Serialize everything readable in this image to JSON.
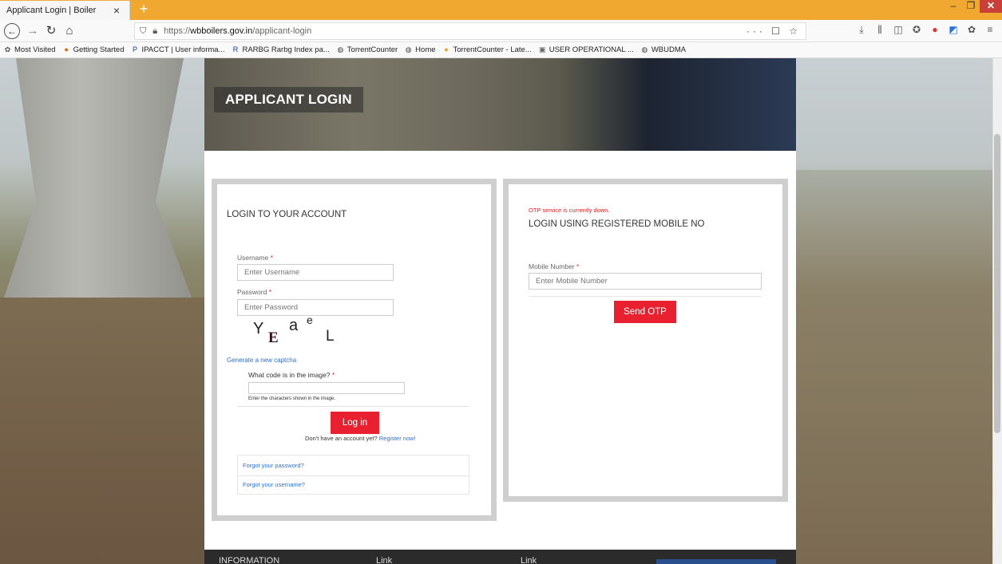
{
  "browser": {
    "tab_title": "Applicant Login | Boiler",
    "tab_close": "×",
    "new_tab": "+",
    "url_prefix": "https://",
    "url_domain": "wbboilers.gov.in",
    "url_path": "/applicant-login",
    "url_actions": "··· ☐ ☆",
    "bookmarks": [
      {
        "label": "Most Visited",
        "icon": "gear-icon",
        "glyph": "✿",
        "color": "#555555"
      },
      {
        "label": "Getting Started",
        "icon": "firefox-icon",
        "glyph": "●",
        "color": "#e66000"
      },
      {
        "label": "IPACCT | User informa...",
        "icon": "ip-icon",
        "glyph": "P",
        "color": "#1a3a8a"
      },
      {
        "label": "RARBG Rarbg Index pa...",
        "icon": "r-icon",
        "glyph": "R",
        "color": "#1a3a8a"
      },
      {
        "label": "TorrentCounter",
        "icon": "globe-icon",
        "glyph": "◍",
        "color": "#444444"
      },
      {
        "label": "Home",
        "icon": "globe-icon",
        "glyph": "◍",
        "color": "#444444"
      },
      {
        "label": "TorrentCounter - Late...",
        "icon": "torrent-icon",
        "glyph": "●",
        "color": "#f0a020"
      },
      {
        "label": "USER OPERATIONAL ...",
        "icon": "document-icon",
        "glyph": "▣",
        "color": "#666666"
      },
      {
        "label": "WBUDMA",
        "icon": "globe-icon",
        "glyph": "◍",
        "color": "#444444"
      }
    ]
  },
  "page": {
    "banner_title": "APPLICANT LOGIN",
    "login": {
      "heading": "LOGIN TO YOUR ACCOUNT",
      "username_label": "Username",
      "username_placeholder": "Enter Username",
      "password_label": "Password",
      "password_placeholder": "Enter Password",
      "captcha_chars": [
        "Y",
        "E",
        "a",
        "e",
        "L"
      ],
      "new_captcha": "Generate a new captcha",
      "captcha_question": "What code is in the image?",
      "captcha_help": "Enter the characters shown in the image.",
      "login_button": "Log in",
      "no_account": "Don't have an account yet?",
      "register": "Register now!",
      "forgot_password": "Forgot your password?",
      "forgot_username": "Forgot your username?",
      "required_mark": "*"
    },
    "mobile": {
      "otp_warning": "OTP service is currently down.",
      "heading": "LOGIN USING REGISTERED MOBILE NO",
      "mobile_label": "Mobile Number",
      "mobile_placeholder": "Enter Mobile Number",
      "send_button": "Send OTP"
    },
    "footer": {
      "col1": "INFORMATION",
      "col2": "Link",
      "col3": "Link"
    }
  }
}
